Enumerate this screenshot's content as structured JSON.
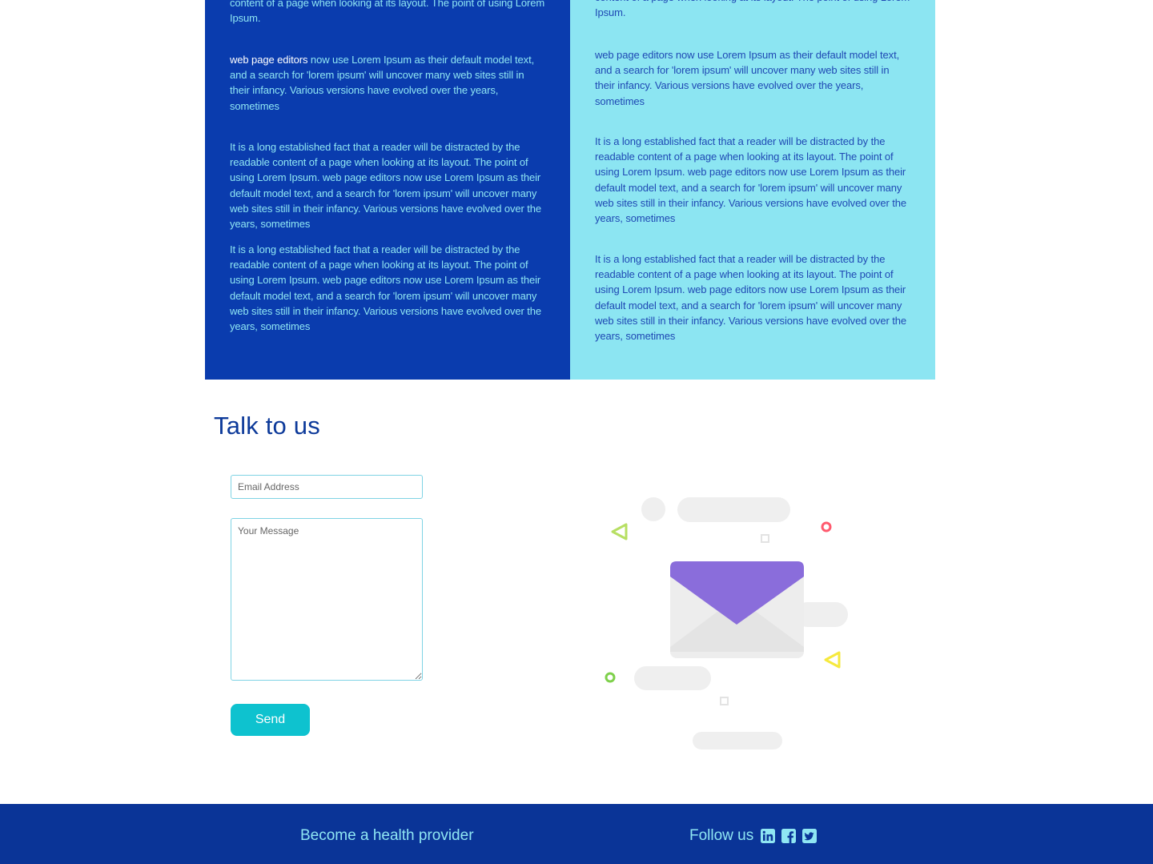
{
  "info": {
    "left": {
      "p1": "content of a page when looking at its layout. The point of using Lorem Ipsum.",
      "p2_highlight": "web page editors",
      "p2_rest": " now use Lorem Ipsum as their default model text, and a search for 'lorem ipsum' will uncover many web sites still in their infancy. Various versions have evolved over the years, sometimes",
      "p3": "It is a long established fact that a reader will be distracted by the readable content of a page when looking at its layout. The point of using Lorem Ipsum. web page editors now use Lorem Ipsum as their default model text, and a search for 'lorem ipsum' will uncover many web sites still in their infancy. Various versions have evolved over the years, sometimes",
      "p4": "It is a long established fact that a reader will be distracted by the readable content of a page when looking at its layout. The point of using Lorem Ipsum. web page editors now use Lorem Ipsum as their default model text, and a search for 'lorem ipsum' will uncover many web sites still in their infancy. Various versions have evolved over the years, sometimes"
    },
    "right": {
      "p1": "content of a page when looking at its layout. The point of using Lorem Ipsum.",
      "p2": "web page editors now use Lorem Ipsum as their default model text, and a search for 'lorem ipsum' will uncover many web sites still in their infancy. Various versions have evolved over the years, sometimes",
      "p3": "It is a long established fact that a reader will be distracted by the readable content of a page when looking at its layout. The point of using Lorem Ipsum. web page editors now use Lorem Ipsum as their default model text, and a search for 'lorem ipsum' will uncover many web sites still in their infancy. Various versions have evolved over the years, sometimes",
      "p4": "It is a long established fact that a reader will be distracted by the readable content of a page when looking at its layout. The point of using Lorem Ipsum. web page editors now use Lorem Ipsum as their default model text, and a search for 'lorem ipsum' will uncover many web sites still in their infancy. Various versions have evolved over the years, sometimes"
    }
  },
  "contact": {
    "title": "Talk to us",
    "email_placeholder": "Email Address",
    "email_value": "",
    "message_placeholder": "Your Message",
    "message_value": "",
    "send_label": "Send",
    "illustration_icon": "envelope-illustration"
  },
  "footer": {
    "provider_link": "Become a health provider",
    "follow_label": "Follow us",
    "social": [
      {
        "icon": "linkedin-icon"
      },
      {
        "icon": "facebook-icon"
      },
      {
        "icon": "twitter-icon"
      }
    ]
  },
  "colors": {
    "dark_panel": "#0a3cae",
    "light_panel": "#8ce5f2",
    "accent": "#0ec2cf",
    "footer": "#0a3497",
    "title": "#0d3a9a"
  }
}
